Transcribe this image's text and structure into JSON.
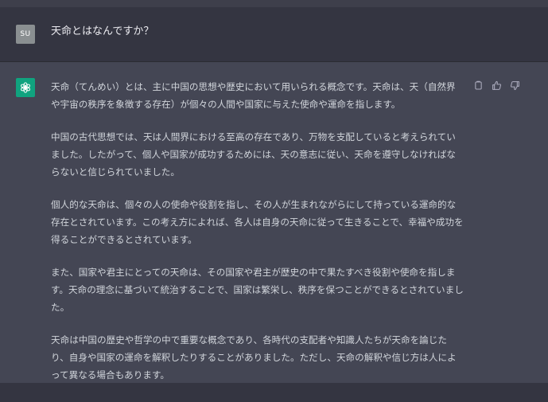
{
  "user_message": {
    "avatar_initials": "SU",
    "text": "天命とはなんですか？"
  },
  "assistant_message": {
    "avatar_icon": "openai-logo-icon",
    "paragraphs": [
      "天命（てんめい）とは、主に中国の思想や歴史において用いられる概念です。天命は、天（自然界や宇宙の秩序を象徴する存在）が個々の人間や国家に与えた使命や運命を指します。",
      "中国の古代思想では、天は人間界における至高の存在であり、万物を支配していると考えられていました。したがって、個人や国家が成功するためには、天の意志に従い、天命を遵守しなければならないと信じられていました。",
      "個人的な天命は、個々の人の使命や役割を指し、その人が生まれながらにして持っている運命的な存在とされています。この考え方によれば、各人は自身の天命に従って生きることで、幸福や成功を得ることができるとされています。",
      "また、国家や君主にとっての天命は、その国家や君主が歴史の中で果たすべき役割や使命を指します。天命の理念に基づいて統治することで、国家は繁栄し、秩序を保つことができるとされていました。",
      "天命は中国の歴史や哲学の中で重要な概念であり、各時代の支配者や知識人たちが天命を論じたり、自身や国家の運命を解釈したりすることがありました。ただし、天命の解釈や信じ方は人によって異なる場合もあります。"
    ],
    "actions": [
      "copy-icon",
      "thumbs-up-icon",
      "thumbs-down-icon"
    ]
  },
  "colors": {
    "user_bg": "#343541",
    "assistant_bg": "#444654",
    "accent": "#10a37f",
    "user_avatar": "#8a8f91",
    "text": "#d1d5db"
  }
}
